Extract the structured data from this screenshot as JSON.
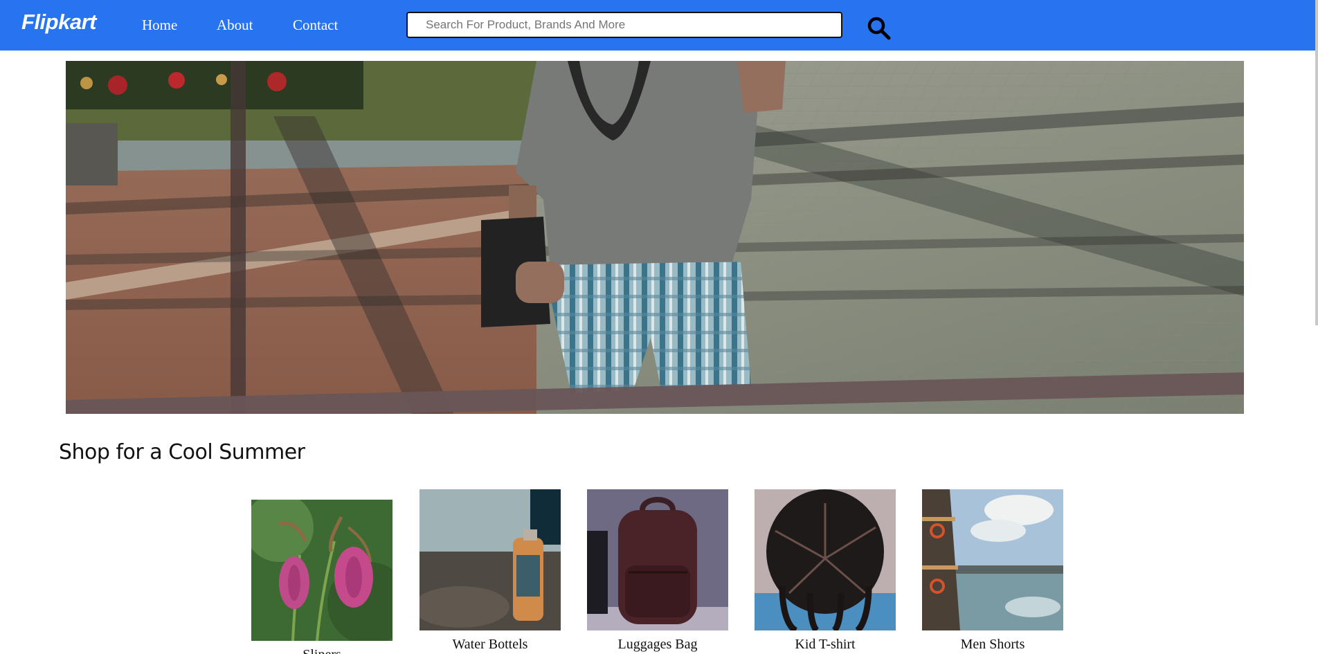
{
  "navbar": {
    "logo": "Flipkart",
    "links": [
      "Home",
      "About",
      "Contact"
    ],
    "search": {
      "placeholder": "Search For Product, Brands And More",
      "value": ""
    },
    "search_icon": "search-icon",
    "background": "#2874f0"
  },
  "hero": {
    "image": "man-with-shoulder-bag-photo"
  },
  "section": {
    "title": "Shop for a Cool Summer"
  },
  "products": [
    {
      "label": "Slipers",
      "image": "pink-orchid-photo"
    },
    {
      "label": "Water Bottels",
      "image": "water-bottle-photo"
    },
    {
      "label": "Luggages Bag",
      "image": "backpack-photo"
    },
    {
      "label": "Kid T-shirt",
      "image": "braided-hair-photo"
    },
    {
      "label": "Men Shorts",
      "image": "ferry-sea-photo"
    }
  ]
}
